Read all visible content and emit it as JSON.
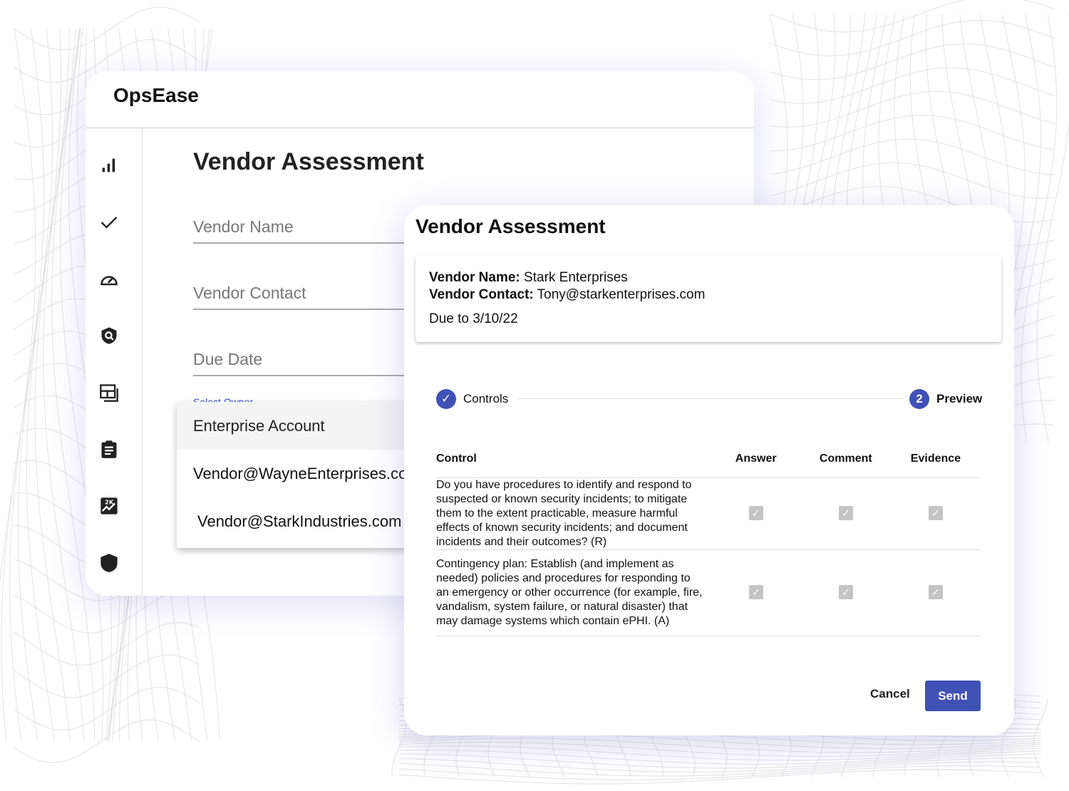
{
  "app": {
    "name": "OpsEase"
  },
  "sidebar": {
    "icons": [
      "bar-chart-icon",
      "check-icon",
      "speedometer-icon",
      "shield-search-icon",
      "dashboard-icon",
      "clipboard-icon",
      "analytics-icon",
      "shield-icon"
    ]
  },
  "form": {
    "title": "Vendor Assessment",
    "vendor_name_placeholder": "Vendor Name",
    "vendor_contact_placeholder": "Vendor Contact",
    "due_date_placeholder": "Due Date",
    "owner_label": "Select Owner",
    "owner_options": [
      "Enterprise Account",
      "Vendor@WayneEnterprises.com",
      "Vendor@StarkIndustries.com"
    ]
  },
  "dialog": {
    "title": "Vendor Assessment",
    "vendor_name_label": "Vendor Name:",
    "vendor_name": "Stark Enterprises",
    "vendor_contact_label": "Vendor Contact:",
    "vendor_contact": "Tony@starkenterprises.com",
    "due": "Due to 3/10/22",
    "steps": [
      {
        "label": "Controls",
        "state": "done"
      },
      {
        "label": "Preview",
        "number": "2",
        "state": "active"
      }
    ],
    "table": {
      "headers": [
        "Control",
        "Answer",
        "Comment",
        "Evidence"
      ],
      "rows": [
        {
          "control": "Do you have procedures to identify and respond to suspected or known security incidents; to mitigate them to the extent practicable, measure harmful effects of known security incidents; and document incidents and their outcomes? (R)",
          "answer": true,
          "comment": true,
          "evidence": true
        },
        {
          "control": "Contingency plan: Establish (and implement as needed) policies and procedures for responding to an emergency or other occurrence (for example, fire, vandalism, system failure, or natural disaster) that may damage systems which contain ePHI. (A)",
          "answer": true,
          "comment": true,
          "evidence": true
        }
      ]
    },
    "cancel_label": "Cancel",
    "send_label": "Send"
  },
  "colors": {
    "accent": "#3f51b5",
    "owner_label": "#3a4bd0"
  }
}
